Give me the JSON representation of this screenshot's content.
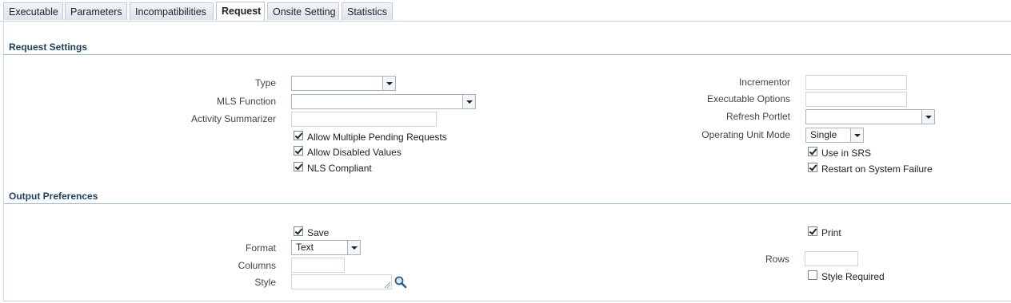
{
  "tabs": [
    {
      "label": "Executable",
      "active": false
    },
    {
      "label": "Parameters",
      "active": false
    },
    {
      "label": "Incompatibilities",
      "active": false
    },
    {
      "label": "Request",
      "active": true
    },
    {
      "label": "Onsite Setting",
      "active": false
    },
    {
      "label": "Statistics",
      "active": false
    }
  ],
  "request_settings": {
    "title": "Request Settings",
    "type": {
      "label": "Type",
      "value": ""
    },
    "mls_function": {
      "label": "MLS Function",
      "value": ""
    },
    "activity_summarizer": {
      "label": "Activity Summarizer",
      "value": ""
    },
    "allow_multiple_pending": {
      "label": "Allow Multiple Pending Requests",
      "checked": true
    },
    "allow_disabled_values": {
      "label": "Allow Disabled Values",
      "checked": true
    },
    "nls_compliant": {
      "label": "NLS Compliant",
      "checked": true
    },
    "incrementor": {
      "label": "Incrementor",
      "value": ""
    },
    "executable_options": {
      "label": "Executable Options",
      "value": ""
    },
    "refresh_portlet": {
      "label": "Refresh Portlet",
      "value": ""
    },
    "operating_unit_mode": {
      "label": "Operating Unit Mode",
      "value": "Single"
    },
    "use_in_srs": {
      "label": "Use in SRS",
      "checked": true
    },
    "restart_on_failure": {
      "label": "Restart on System Failure",
      "checked": true
    }
  },
  "output_preferences": {
    "title": "Output Preferences",
    "save": {
      "label": "Save",
      "checked": true
    },
    "format": {
      "label": "Format",
      "value": "Text"
    },
    "columns": {
      "label": "Columns",
      "value": ""
    },
    "style": {
      "label": "Style",
      "value": ""
    },
    "print": {
      "label": "Print",
      "checked": true
    },
    "rows": {
      "label": "Rows",
      "value": ""
    },
    "style_required": {
      "label": "Style Required",
      "checked": false
    }
  },
  "icons": {
    "search": "search-icon",
    "dropdown": "chevron-down-icon"
  },
  "colors": {
    "section_title": "#1d3f5e",
    "section_line": "#9fb6c8"
  }
}
